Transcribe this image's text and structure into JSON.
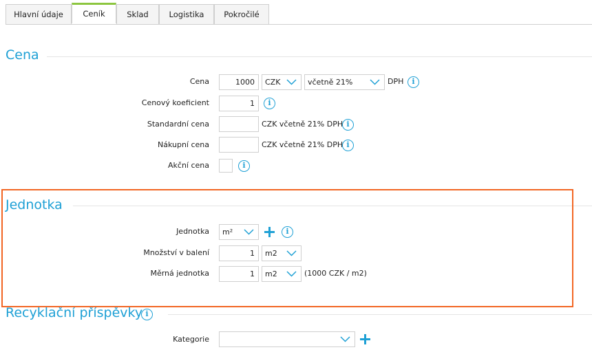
{
  "tabs": [
    "Hlavní údaje",
    "Ceník",
    "Sklad",
    "Logistika",
    "Pokročilé"
  ],
  "active_tab": "Ceník",
  "sections": {
    "cena": {
      "title": "Cena",
      "price_label": "Cena",
      "price_value": "1000",
      "currency": "CZK",
      "vat_option": "včetně 21%",
      "dph": "DPH",
      "coef_label": "Cenový koeficient",
      "coef_value": "1",
      "standard_label": "Standardní cena",
      "standard_value": "",
      "standard_suffix": "CZK včetně 21% DPH",
      "purchase_label": "Nákupní cena",
      "purchase_value": "",
      "purchase_suffix": "CZK včetně 21% DPH",
      "sale_label": "Akční cena"
    },
    "jednotka": {
      "title": "Jednotka",
      "unit_label": "Jednotka",
      "unit_value": "m²",
      "pack_label": "Množství v balení",
      "pack_value": "1",
      "pack_unit": "m2",
      "measure_label": "Měrná jednotka",
      "measure_value": "1",
      "measure_unit": "m2",
      "measure_note": "(1000 CZK / m2)"
    },
    "recyklacni": {
      "title": "Recyklační příspěvky",
      "category_label": "Kategorie",
      "category_value": ""
    }
  },
  "colors": {
    "accent": "#1ea0d5",
    "active_tab": "#8cc63f",
    "highlight": "#f26522"
  },
  "icons": [
    "info-icon",
    "plus-icon",
    "chevron-down-icon"
  ]
}
